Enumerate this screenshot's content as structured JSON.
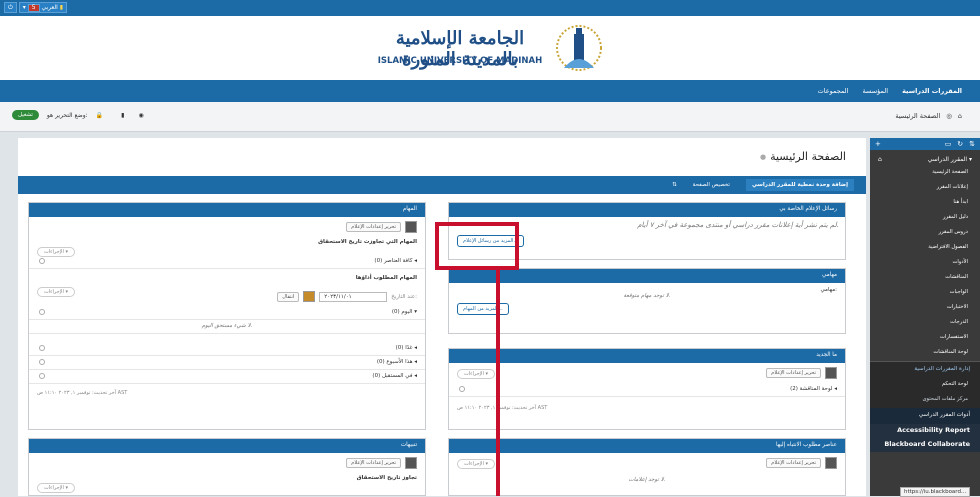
{
  "topbar": {
    "power_icon": "power-icon",
    "user_label": "العربي",
    "badge": "5"
  },
  "banner": {
    "logo_ar": "الجامعة الإسلامية بالمدينة المنورة",
    "logo_en": "ISLAMIC UNIVERSITY OF MADINAH"
  },
  "nav": {
    "items": [
      "المقررات الدراسية",
      "المؤسسة",
      "المجموعات"
    ]
  },
  "breadcrumb": {
    "label": "الصفحة الرئيسية"
  },
  "tools": {
    "edit_mode_label": "وضع التحرير هو:",
    "edit_mode_state": "تشغيل"
  },
  "page": {
    "title": "الصفحة الرئيسية"
  },
  "subbar": {
    "add_module": "إضافة وحدة نمطية للمقرر الدراسي",
    "customize": "تخصيص الصفحة"
  },
  "retention": {
    "title": "رسائل الإعلام الخاصة بي",
    "empty": "لم يتم نشر أية إعلانات مقرر دراسي أو منتدى مجموعة في آخر ٧ أيام.",
    "more": "المزيد من رسائل الإعلام..."
  },
  "tasks_right": {
    "title": "مهامي",
    "label": "مهامي:",
    "empty": "لا توجد مهام متوقعة.",
    "more": "المزيد من المهام..."
  },
  "whats_new": {
    "title": "ما الجديد",
    "edit": "تحرير إعدادات الإعلام",
    "actions": "الإجراءات",
    "item": "لوحة المناقشة (2)",
    "updated": "آخر تحديث: توفمبر ١, ٢٠٢٣ ١١:١٠ ص AST"
  },
  "needs_attention": {
    "title": "عناصر مطلوب الانتباه إليها",
    "edit": "تحرير إعدادات الإعلام",
    "actions": "الإجراءات",
    "empty": "لا توجد إعلامات."
  },
  "tasks_left": {
    "title": "المهام",
    "edit": "تحرير إعدادات الإعلام",
    "overdue_title": "المهام التي تجاوزت تاريخ الاستحقاق",
    "actions": "الإجراءات",
    "all_items": "كافة العناصر (0)",
    "due_title": "المهام المطلوب أداؤها",
    "date_label": "عند التاريخ:",
    "date_value": "٢٠٢٣/١١/٠١",
    "go": "انتقال",
    "today": "اليوم (0)",
    "today_empty": "لا شيء مستحق اليوم.",
    "tomorrow": "غدًا (0)",
    "this_week": "هذا الأسبوع (0)",
    "future": "في المستقبل (0)",
    "updated": "آخر تحديث: توفمبر ١, ٢٠٢٣ ١١:١٠ ص AST"
  },
  "alerts": {
    "title": "تنبيهات",
    "edit": "تحرير إعدادات الإعلام",
    "actions": "الإجراءات",
    "past_due": "تجاوز تاريخ الاستحقاق"
  },
  "sidebar": {
    "root": "المقرر الدراسي",
    "items": [
      "الصفحة الرئيسية",
      "إعلانات المقرر",
      "ابدأ هنا",
      "دليل المقرر",
      "دروس المقرر",
      "الفصول الافتراضية",
      "الأدوات",
      "المناقشات",
      "الواجبات",
      "الاختبارات",
      "الدرجات",
      "الاستفسارات",
      "لوحة المناقشات"
    ],
    "mgmt": "إدارة المقررات الدراسية",
    "control_panel": "لوحة التحكم",
    "content_collection": "مركز ملفات المحتوى",
    "course_tools": "أدوات المقرر الدراسي",
    "accessibility": "Accessibility Report",
    "collaborate": "Blackboard Collaborate"
  },
  "status_url": "https://iu.blackboard..."
}
